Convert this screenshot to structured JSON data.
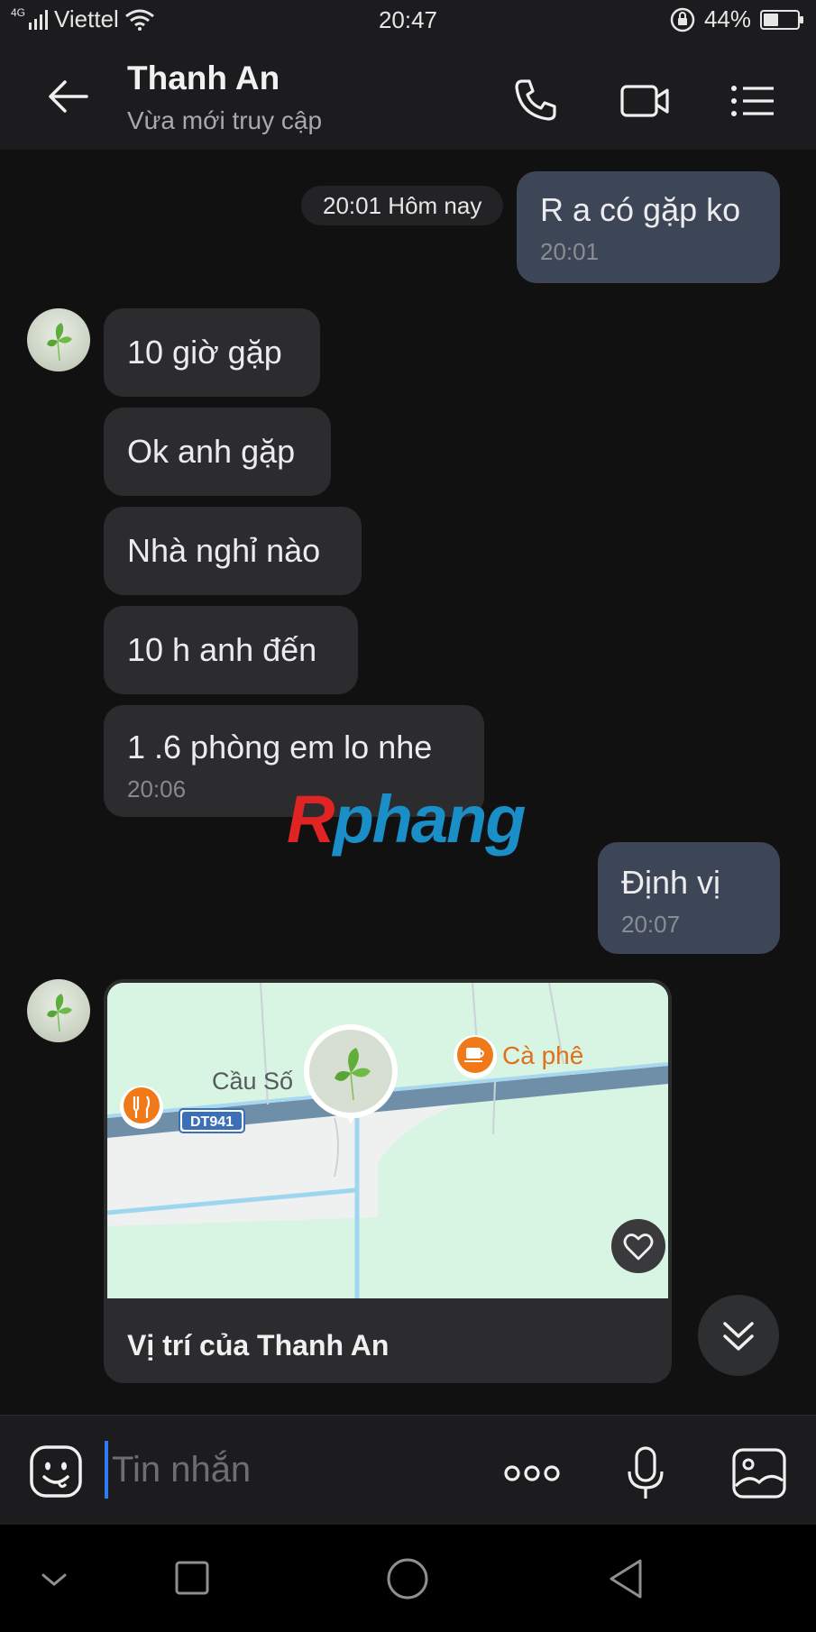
{
  "status_bar": {
    "network_type": "4G",
    "carrier": "Viettel",
    "time": "20:47",
    "battery_percent": "44%",
    "battery_level": 0.44
  },
  "header": {
    "contact_name": "Thanh An",
    "status": "Vừa mới truy cập",
    "icons": [
      "back-arrow-icon",
      "phone-icon",
      "video-camera-icon",
      "list-menu-icon"
    ]
  },
  "chat": {
    "date_chip": "20:01 Hôm nay",
    "messages": [
      {
        "direction": "out",
        "text": "R a có gặp ko",
        "time": "20:01"
      },
      {
        "direction": "in",
        "text": "10 giờ gặp"
      },
      {
        "direction": "in",
        "text": "Ok anh gặp"
      },
      {
        "direction": "in",
        "text": "Nhà nghỉ nào"
      },
      {
        "direction": "in",
        "text": "10 h anh đến"
      },
      {
        "direction": "in",
        "text": "1 .6 phòng em lo nhe",
        "time": "20:06"
      },
      {
        "direction": "out",
        "text": "Định vị",
        "time": "20:07"
      }
    ],
    "location_card": {
      "label": "Vị trí của Thanh An",
      "map_labels": {
        "place": "Cầu Số",
        "road": "DT941",
        "poi": "Cà phê"
      }
    }
  },
  "watermark": {
    "first": "R",
    "rest": "phang"
  },
  "input_bar": {
    "placeholder": "Tin nhắn",
    "icons": [
      "emoji-icon",
      "more-dots-icon",
      "microphone-icon",
      "image-icon"
    ]
  },
  "colors": {
    "background": "#111112",
    "header": "#1c1c1e",
    "bubble_in": "#2c2c2e",
    "bubble_out": "#3d4656",
    "accent": "#2d7cf6",
    "poi_orange": "#f07a1a"
  }
}
